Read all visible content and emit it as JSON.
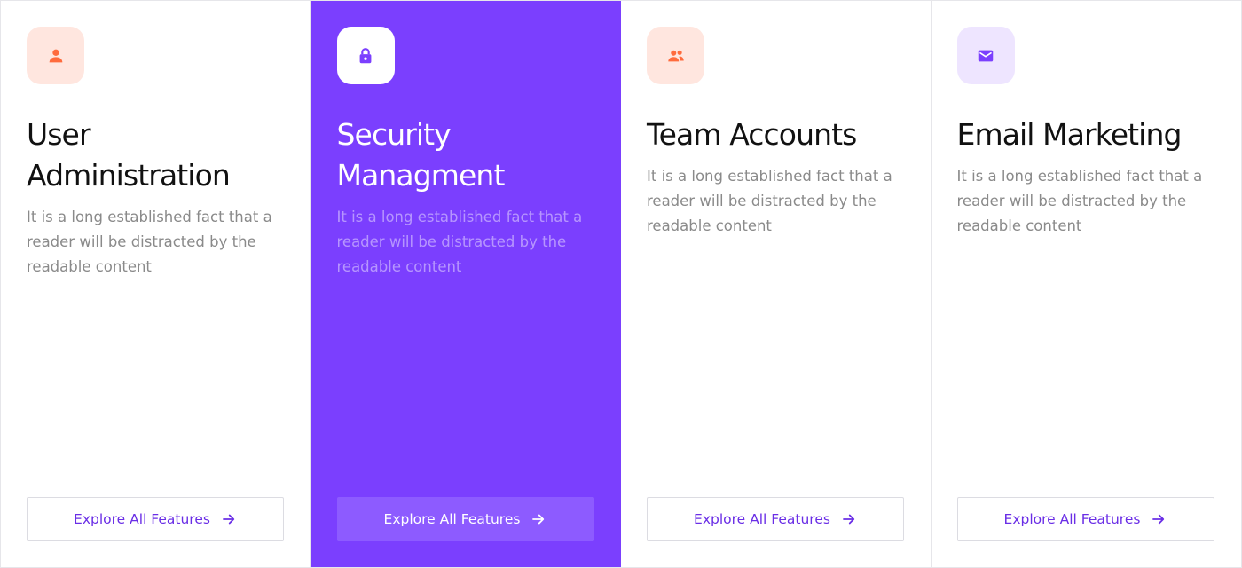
{
  "colors": {
    "accent": "#7b3ffe",
    "accent_button": "#8d5bff",
    "orange_icon": "#ff6b3d",
    "orange_tile": "#ffe6df",
    "purple_tile": "#eee5ff",
    "link_text": "#6a2ee6"
  },
  "cards": [
    {
      "icon": "user-icon",
      "title_line1": "User",
      "title_line2": "Administration",
      "description": "It is a long established fact that a reader will be distracted by the readable content",
      "button_label": "Explore All Features",
      "active": false
    },
    {
      "icon": "lock-icon",
      "title_line1": "Security",
      "title_line2": "Managment",
      "description": "It is a long established fact that a reader will be distracted by the readable content",
      "button_label": "Explore All Features",
      "active": true
    },
    {
      "icon": "team-icon",
      "title_line1": "Team Accounts",
      "description": "It is a long established fact that a reader will be distracted by the readable content",
      "button_label": "Explore All Features",
      "active": false
    },
    {
      "icon": "mail-icon",
      "title_line1": "Email Marketing",
      "description": "It is a long established fact that a reader will be distracted by the readable content",
      "button_label": "Explore All Features",
      "active": false
    }
  ]
}
